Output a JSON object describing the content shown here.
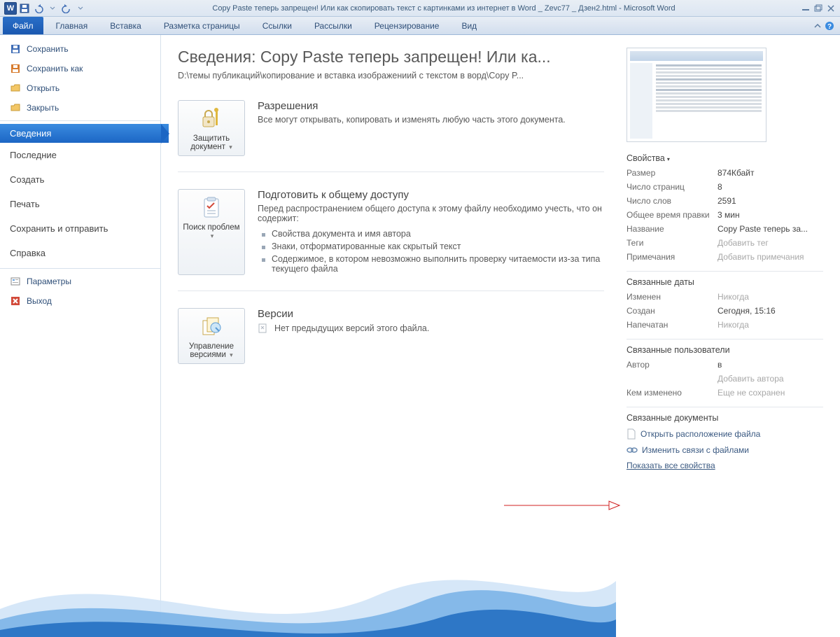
{
  "titlebar": {
    "title": "Copy Paste теперь запрещен! Или как скопировать текст с картинками из интернет в Word _ Zevc77 _ Дзен2.html - Microsoft Word"
  },
  "ribbon": {
    "file": "Файл",
    "tabs": [
      "Главная",
      "Вставка",
      "Разметка страницы",
      "Ссылки",
      "Рассылки",
      "Рецензирование",
      "Вид"
    ]
  },
  "sidebar": {
    "top": [
      {
        "label": "Сохранить"
      },
      {
        "label": "Сохранить как"
      },
      {
        "label": "Открыть"
      },
      {
        "label": "Закрыть"
      }
    ],
    "mid": [
      {
        "label": "Сведения",
        "selected": true
      },
      {
        "label": "Последние"
      },
      {
        "label": "Создать"
      },
      {
        "label": "Печать"
      },
      {
        "label": "Сохранить и отправить"
      },
      {
        "label": "Справка"
      }
    ],
    "foot": [
      {
        "label": "Параметры"
      },
      {
        "label": "Выход"
      }
    ]
  },
  "info": {
    "title": "Сведения: Copy Paste теперь запрещен! Или ка...",
    "path": "D:\\темы публикаций\\копирование и вставка изображениий с текстом в ворд\\Copy P...",
    "sec1": {
      "button": "Защитить документ",
      "head": "Разрешения",
      "text": "Все могут открывать, копировать и изменять любую часть этого документа."
    },
    "sec2": {
      "button": "Поиск проблем",
      "head": "Подготовить к общему доступу",
      "text": "Перед распространением общего доступа к этому файлу необходимо учесть, что он содержит:",
      "items": [
        "Свойства документа и имя автора",
        "Знаки, отформатированные как скрытый текст",
        "Содержимое, в котором невозможно выполнить проверку читаемости из-за типа текущего файла"
      ]
    },
    "sec3": {
      "button": "Управление версиями",
      "head": "Версии",
      "text": "Нет предыдущих версий этого файла."
    }
  },
  "props": {
    "head": "Свойства",
    "rows": [
      {
        "k": "Размер",
        "v": "874Кбайт"
      },
      {
        "k": "Число страниц",
        "v": "8"
      },
      {
        "k": "Число слов",
        "v": "2591"
      },
      {
        "k": "Общее время правки",
        "v": "3 мин"
      },
      {
        "k": "Название",
        "v": "Copy Paste теперь за..."
      },
      {
        "k": "Теги",
        "v": "Добавить тег",
        "ghost": true
      },
      {
        "k": "Примечания",
        "v": "Добавить примечания",
        "ghost": true
      }
    ],
    "dates_title": "Связанные даты",
    "dates": [
      {
        "k": "Изменен",
        "v": "Никогда",
        "ghost": true
      },
      {
        "k": "Создан",
        "v": "Сегодня, 15:16"
      },
      {
        "k": "Напечатан",
        "v": "Никогда",
        "ghost": true
      }
    ],
    "users_title": "Связанные пользователи",
    "users": [
      {
        "k": "Автор",
        "v": "в"
      },
      {
        "k": "",
        "v": "Добавить автора",
        "ghost": true
      },
      {
        "k": "Кем изменено",
        "v": "Еще не сохранен",
        "ghost": true
      }
    ],
    "docs_title": "Связанные документы",
    "open_location": "Открыть расположение файла",
    "edit_links": "Изменить связи с файлами",
    "show_all": "Показать все свойства"
  }
}
